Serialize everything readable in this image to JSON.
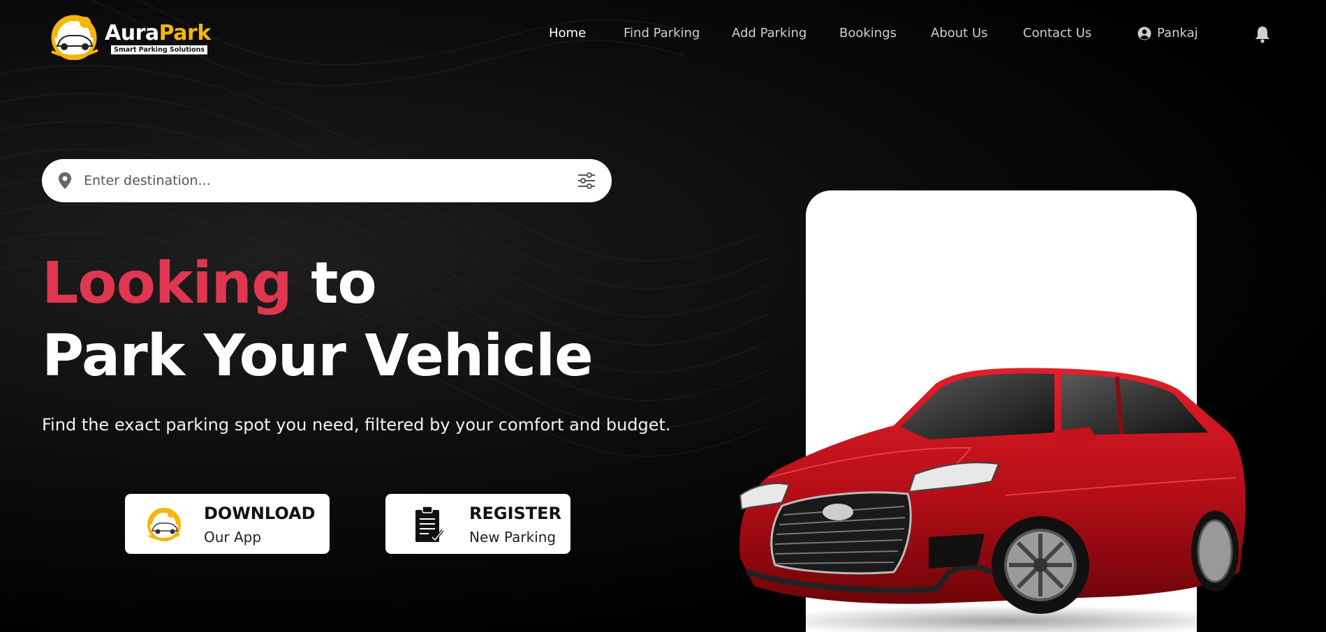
{
  "brand": {
    "name_part1": "Aura",
    "name_part2": "Park",
    "tagline": "Smart Parking Solutions",
    "colors": {
      "accent": "#e0364f",
      "brand_yellow": "#f5b50a",
      "background": "#000000"
    }
  },
  "nav": {
    "items": [
      {
        "label": "Home",
        "active": true
      },
      {
        "label": "Find Parking",
        "active": false
      },
      {
        "label": "Add Parking",
        "active": false
      },
      {
        "label": "Bookings",
        "active": false
      },
      {
        "label": "About Us",
        "active": false
      },
      {
        "label": "Contact Us",
        "active": false
      }
    ],
    "user": {
      "name": "Pankaj",
      "icon": "user-circle-icon"
    },
    "notifications_icon": "bell-icon"
  },
  "search": {
    "placeholder": "Enter destination...",
    "value": "",
    "leading_icon": "map-pin-icon",
    "trailing_icon": "filter-sliders-icon"
  },
  "hero": {
    "headline_accent": "Looking",
    "headline_rest": "to",
    "headline_line2": "Park Your Vehicle",
    "subtitle": "Find the exact parking spot you need, filtered by your comfort and budget."
  },
  "cta": {
    "download": {
      "title": "DOWNLOAD",
      "subtitle": "Our App",
      "icon": "app-logo-icon"
    },
    "register": {
      "title": "REGISTER",
      "subtitle": "New Parking",
      "icon": "clipboard-check-icon"
    }
  },
  "hero_image": {
    "subject": "red-sedan",
    "card_color": "#ffffff"
  }
}
